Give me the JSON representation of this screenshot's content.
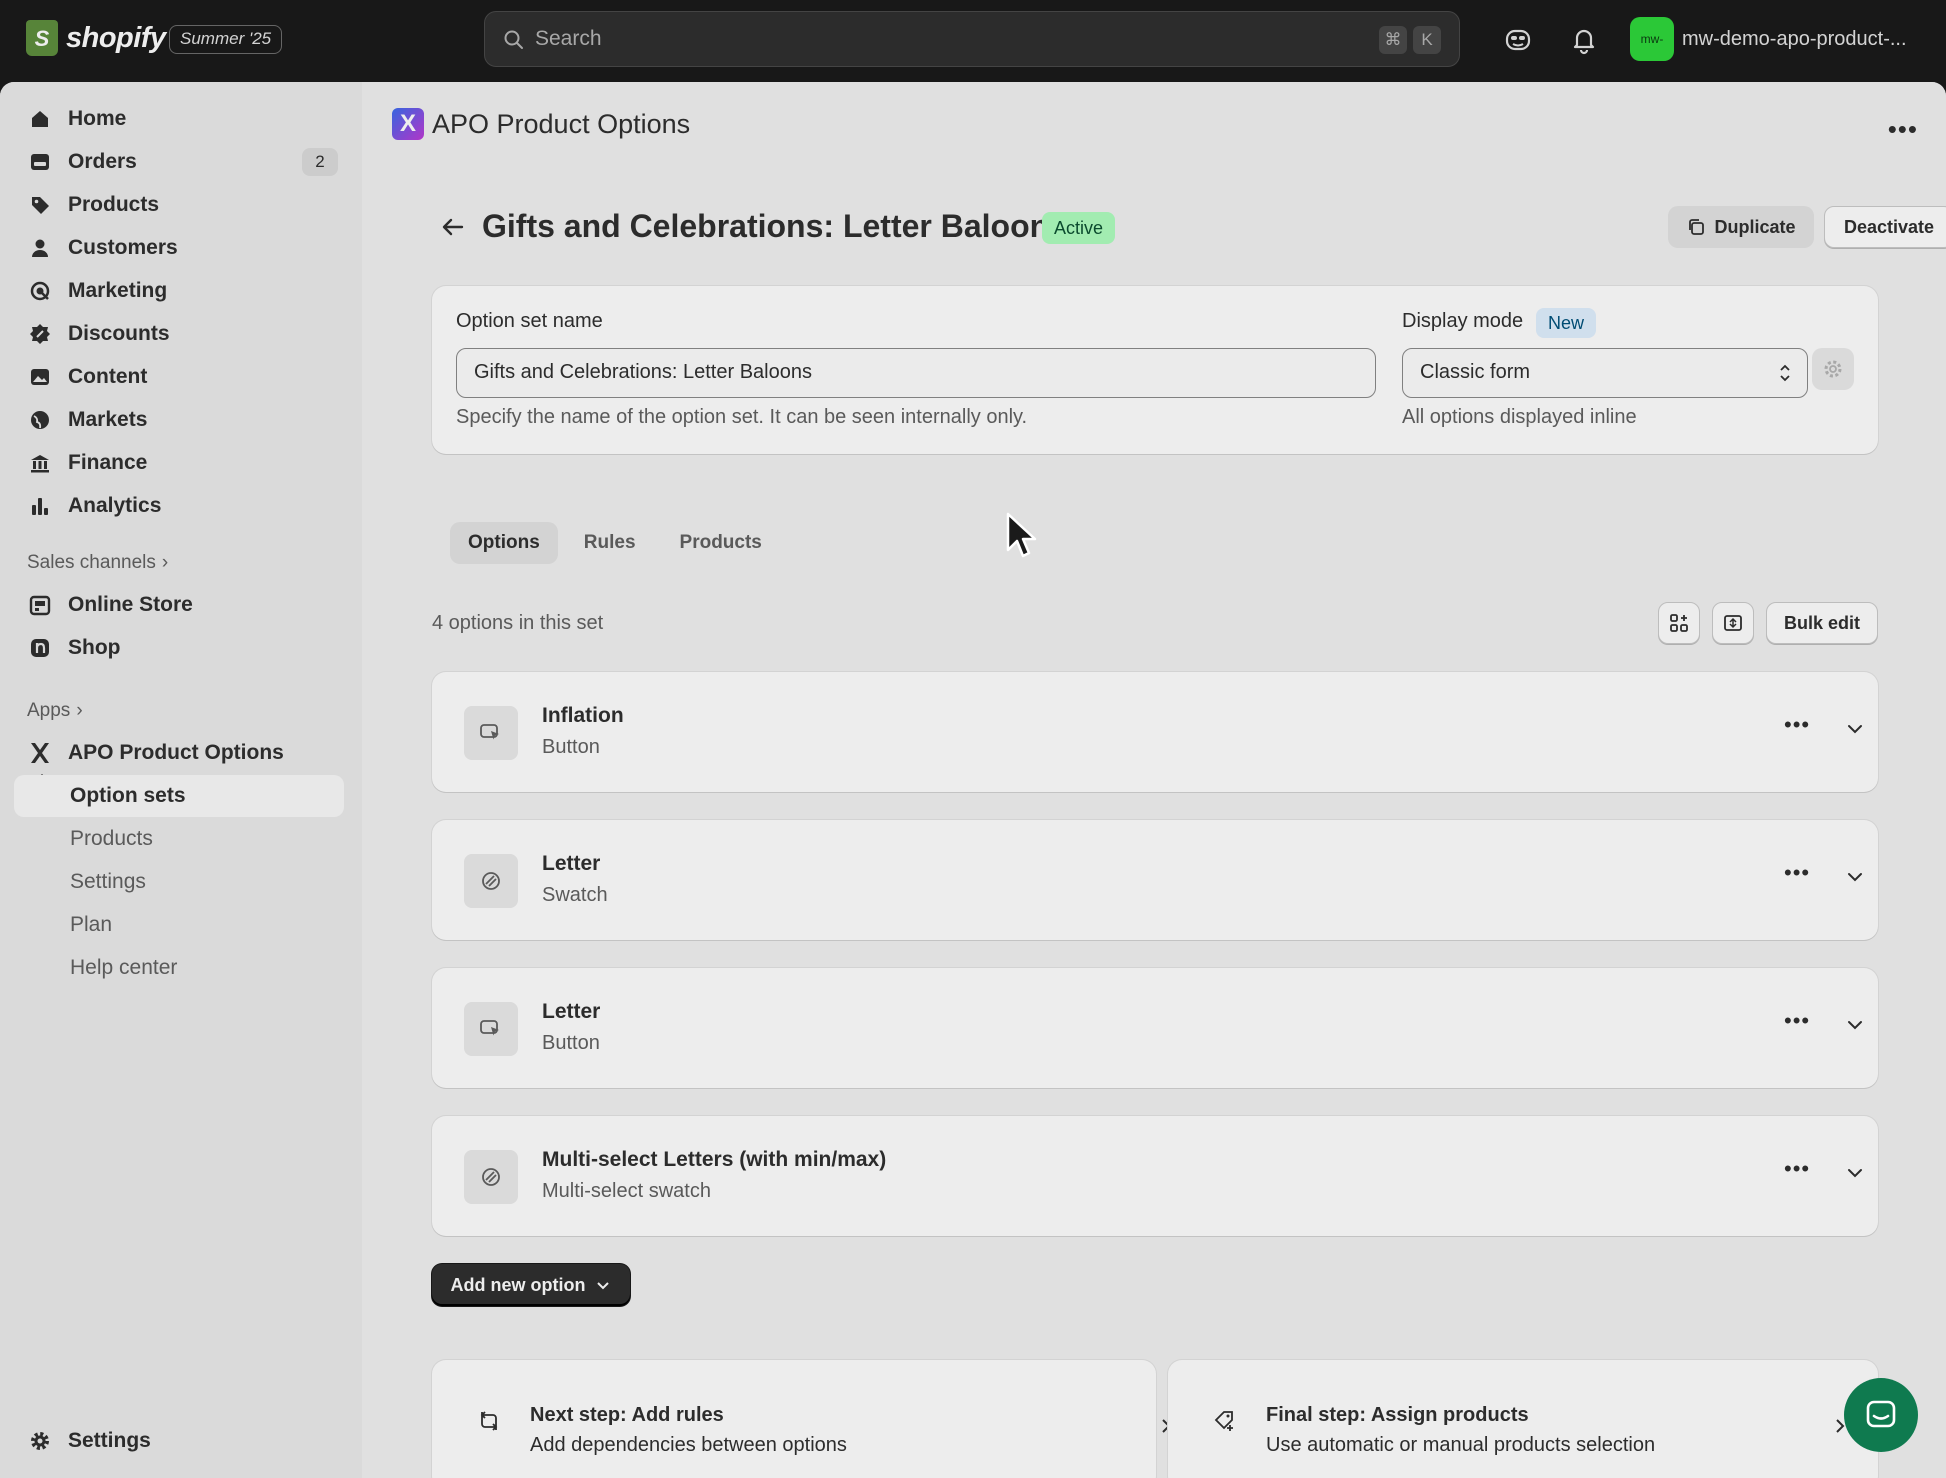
{
  "topbar": {
    "brand": "shopify",
    "edition": "Summer '25",
    "search_placeholder": "Search",
    "shortcut_cmd": "⌘",
    "shortcut_key": "K",
    "store_avatar": "mw-",
    "store_name": "mw-demo-apo-product-..."
  },
  "sidebar": {
    "items": [
      {
        "label": "Home",
        "icon": "home-icon"
      },
      {
        "label": "Orders",
        "icon": "orders-icon",
        "badge": "2"
      },
      {
        "label": "Products",
        "icon": "tag-icon"
      },
      {
        "label": "Customers",
        "icon": "person-icon"
      },
      {
        "label": "Marketing",
        "icon": "target-icon"
      },
      {
        "label": "Discounts",
        "icon": "discount-icon"
      },
      {
        "label": "Content",
        "icon": "image-icon"
      },
      {
        "label": "Markets",
        "icon": "globe-icon"
      },
      {
        "label": "Finance",
        "icon": "bank-icon"
      },
      {
        "label": "Analytics",
        "icon": "chart-icon"
      }
    ],
    "sales_channels_label": "Sales channels",
    "channels": [
      {
        "label": "Online Store",
        "icon": "store-icon"
      },
      {
        "label": "Shop",
        "icon": "shop-icon"
      }
    ],
    "apps_label": "Apps",
    "app_name": "APO Product Options",
    "app_sub": [
      "Option sets",
      "Products",
      "Settings",
      "Plan",
      "Help center"
    ],
    "settings_label": "Settings"
  },
  "app_header": {
    "title": "APO Product Options",
    "logo_letter": "X"
  },
  "page": {
    "title": "Gifts and Celebrations: Letter Baloons",
    "status": "Active",
    "duplicate_label": "Duplicate",
    "deactivate_label": "Deactivate"
  },
  "form": {
    "name_label": "Option set name",
    "name_value": "Gifts and Celebrations: Letter Baloons",
    "name_help": "Specify the name of the option set. It can be seen internally only.",
    "display_label": "Display mode",
    "display_badge": "New",
    "display_value": "Classic form",
    "display_help": "All options displayed inline"
  },
  "tabs": [
    "Options",
    "Rules",
    "Products"
  ],
  "options_summary": "4 options in this set",
  "bulk_edit_label": "Bulk edit",
  "options": [
    {
      "title": "Inflation",
      "type": "Button",
      "icon": "cursor-click-icon"
    },
    {
      "title": "Letter",
      "type": "Swatch",
      "icon": "swatch-icon"
    },
    {
      "title": "Letter",
      "type": "Button",
      "icon": "cursor-click-icon"
    },
    {
      "title": "Multi-select Letters (with min/max)",
      "type": "Multi-select swatch",
      "icon": "swatch-icon"
    }
  ],
  "add_option_label": "Add new option",
  "steps": [
    {
      "title": "Next step: Add rules",
      "subtitle": "Add dependencies between options"
    },
    {
      "title": "Final step: Assign products",
      "subtitle": "Use automatic or manual products selection"
    }
  ],
  "colors": {
    "active_badge_bg": "#affebf",
    "new_badge_bg": "#e0f0ff",
    "store_avatar_bg": "#2fd83c",
    "chat_bg": "#0f7a4f"
  }
}
